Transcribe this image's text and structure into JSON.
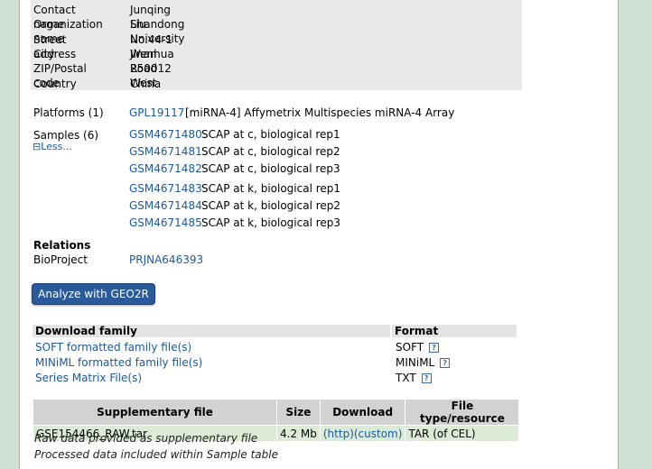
{
  "contact": [
    {
      "key": "Contact name",
      "value": "Junqing Liu"
    },
    {
      "key": "Organization name",
      "value": "Shandong University"
    },
    {
      "key": "Street address",
      "value": "No.44-1 Wenhua Road West"
    },
    {
      "key": "City",
      "value": "Jinan"
    },
    {
      "key": "ZIP/Postal code",
      "value": "250012"
    },
    {
      "key": "Country",
      "value": "China"
    }
  ],
  "platforms": {
    "label": "Platforms (1)",
    "id": "GPL19117",
    "description": "[miRNA-4] Affymetrix Multispecies miRNA-4 Array"
  },
  "samples": {
    "label": "Samples (6)",
    "toggle": "Less...",
    "items": [
      {
        "id": "GSM4671480",
        "desc": "SCAP at c, biological rep1"
      },
      {
        "id": "GSM4671481",
        "desc": "SCAP at c, biological rep2"
      },
      {
        "id": "GSM4671482",
        "desc": "SCAP at c, biological rep3"
      },
      {
        "id": "GSM4671483",
        "desc": "SCAP at k, biological rep1"
      },
      {
        "id": "GSM4671484",
        "desc": "SCAP at k, biological rep2"
      },
      {
        "id": "GSM4671485",
        "desc": "SCAP at k, biological rep3"
      }
    ]
  },
  "relations": {
    "heading": "Relations",
    "bioproject_label": "BioProject",
    "bioproject_id": "PRJNA646393"
  },
  "geo2r_button": "Analyze with GEO2R",
  "download_family": {
    "header": "Download family",
    "format_header": "Format",
    "rows": [
      {
        "label": "SOFT formatted family file(s)",
        "format": "SOFT"
      },
      {
        "label": "MINiML formatted family file(s)",
        "format": "MINiML"
      },
      {
        "label": "Series Matrix File(s)",
        "format": "TXT"
      }
    ]
  },
  "supplementary": {
    "headers": [
      "Supplementary file",
      "Size",
      "Download",
      "File type/resource"
    ],
    "row": {
      "file": "GSE154466_RAW.tar",
      "size": "4.2 Mb",
      "http": "(http)",
      "custom": "(custom)",
      "type": "TAR (of CEL)"
    },
    "notes": [
      "Raw data provided as supplementary file",
      "Processed data included within Sample table"
    ]
  }
}
